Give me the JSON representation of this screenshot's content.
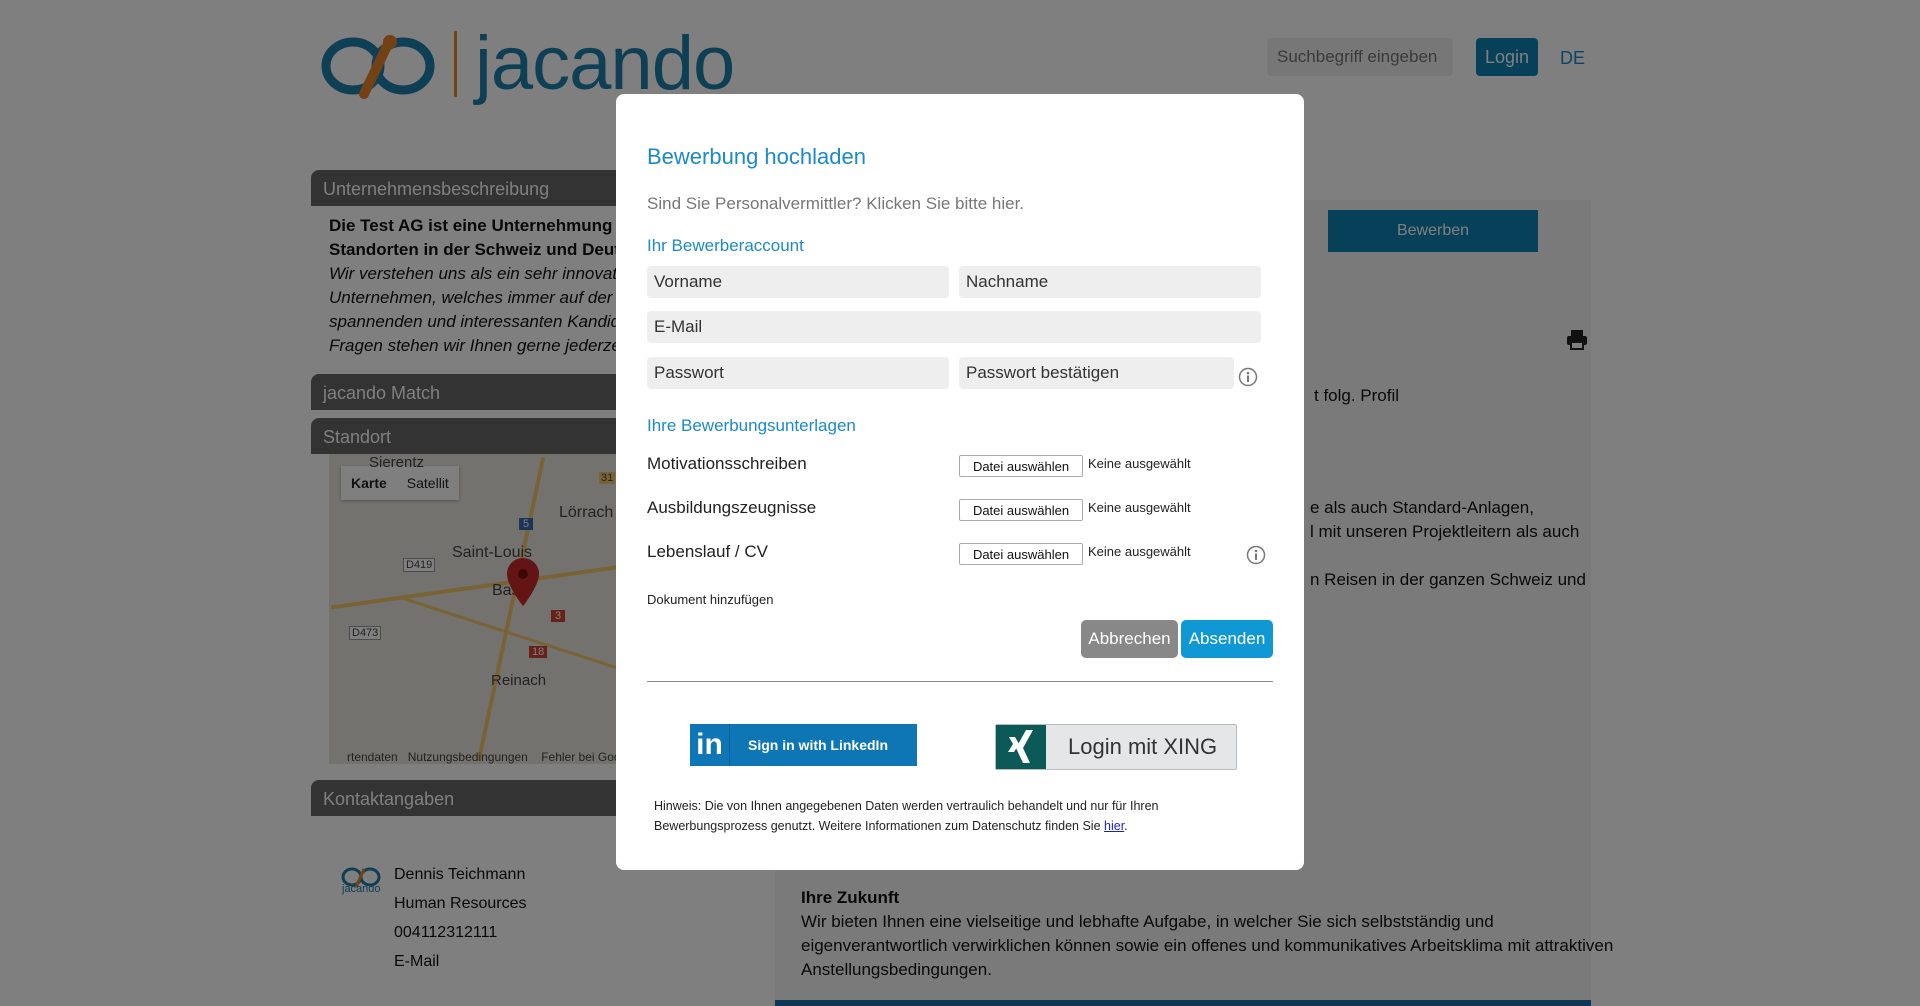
{
  "header": {
    "logo_text": "jacando",
    "search_placeholder": "Suchbegriff eingeben",
    "login_label": "Login",
    "language": "DE"
  },
  "sidebar": {
    "company_heading": "Unternehmensbeschreibung",
    "company_bold_1": "Die Test AG ist eine Unternehmung mit d",
    "company_bold_2": "Standorten in der Schweiz und Deutschla",
    "company_italic_1": "Wir verstehen uns als ein sehr innovative",
    "company_italic_2": "Unternehmen, welches immer auf der Suc",
    "company_italic_3": "spannenden und interessanten Kandidate",
    "company_italic_4": "Fragen stehen wir Ihnen gerne jederzeit z",
    "match_heading": "jacando Match",
    "location_heading": "Standort",
    "map": {
      "tab_map": "Karte",
      "tab_satellite": "Satellit",
      "label_sierentz": "Sierentz",
      "label_loerrach": "Lörrach",
      "label_saint_louis": "Saint-Louis",
      "label_basel": "Basel",
      "label_reinach": "Reinach",
      "road_d419": "D419",
      "road_d473": "D473",
      "road_5": "5",
      "road_3": "3",
      "road_18": "18",
      "road_31": "31",
      "footer_data": "rtendaten",
      "footer_terms": "Nutzungsbedingungen",
      "footer_error": "Fehler bei Goo"
    },
    "contact_heading": "Kontaktangaben",
    "contact": {
      "logo_text": "jacando",
      "name": "Dennis Teichmann",
      "department": "Human Resources",
      "phone": "004112312111",
      "email_label": "E-Mail"
    }
  },
  "main": {
    "apply_label": "Bewerben",
    "text_profile": "t folg. Profil",
    "text_line_1": "e als auch Standard-Anlagen,",
    "text_line_2": "l mit unseren Projektleitern als auch",
    "text_line_3": "n Reisen in der ganzen Schweiz und",
    "future_heading": "Ihre Zukunft",
    "future_1": "Wir bieten Ihnen eine vielseitige und lebhafte Aufgabe, in welcher Sie sich selbstständig und",
    "future_2": "eigenverantwortlich verwirklichen können sowie ein offenes und kommunikatives Arbeitsklima mit attraktiven",
    "future_3": "Anstellungsbedingungen."
  },
  "modal": {
    "title": "Bewerbung hochladen",
    "recruiter_hint": "Sind Sie Personalvermittler? Klicken Sie bitte hier.",
    "account_heading": "Ihr Bewerberaccount",
    "firstname_placeholder": "Vorname",
    "lastname_placeholder": "Nachname",
    "email_placeholder": "E-Mail",
    "password_placeholder": "Passwort",
    "password_confirm_placeholder": "Passwort bestätigen",
    "documents_heading": "Ihre Bewerbungsunterlagen",
    "files": [
      {
        "label": "Motivationsschreiben",
        "button": "Datei auswählen",
        "status": "Keine ausgewählt"
      },
      {
        "label": "Ausbildungszeugnisse",
        "button": "Datei auswählen",
        "status": "Keine ausgewählt"
      },
      {
        "label": "Lebenslauf / CV",
        "button": "Datei auswählen",
        "status": "Keine ausgewählt"
      }
    ],
    "add_document": "Dokument hinzufügen",
    "cancel_label": "Abbrechen",
    "send_label": "Absenden",
    "linkedin_label": "Sign in with LinkedIn",
    "linkedin_logo": "in",
    "xing_label": "Login mit XING",
    "hint_text": "Hinweis: Die von Ihnen angegebenen Daten werden vertraulich behandelt und nur für Ihren Bewerbungsprozess genutzt. Weitere Informationen zum Datenschutz finden Sie ",
    "hint_link": "hier",
    "hint_end": "."
  },
  "colors": {
    "brand_blue": "#1c8ac7",
    "brand_orange": "#e8832a",
    "button_gray": "#888888",
    "linkedin_blue": "#0e76b4",
    "xing_green": "#0b5a57"
  }
}
